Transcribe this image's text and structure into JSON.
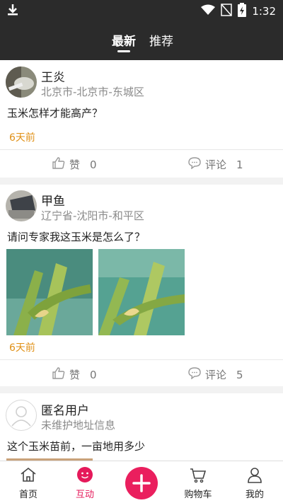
{
  "status": {
    "time": "1:32"
  },
  "tabs": [
    {
      "label": "最新",
      "active": true
    },
    {
      "label": "推荐",
      "active": false
    }
  ],
  "posts": [
    {
      "name": "王炎",
      "location": "北京市-北京市-东城区",
      "question": "玉米怎样才能高产？",
      "time": "6天前",
      "like_label": "赞",
      "like_count": "0",
      "comment_label": "评论",
      "comment_count": "1"
    },
    {
      "name": "甲鱼",
      "location": "辽宁省-沈阳市-和平区",
      "question": "请问专家我这玉米是怎么了？",
      "time": "6天前",
      "like_label": "赞",
      "like_count": "0",
      "comment_label": "评论",
      "comment_count": "5"
    },
    {
      "name": "匿名用户",
      "location": "未维护地址信息",
      "question": "这个玉米苗前，一亩地用多少"
    }
  ],
  "nav": [
    {
      "label": "首页",
      "icon": "home-icon"
    },
    {
      "label": "互动",
      "icon": "interact-icon",
      "active": true
    },
    {
      "label": "",
      "icon": "add-icon"
    },
    {
      "label": "购物车",
      "icon": "cart-icon"
    },
    {
      "label": "我的",
      "icon": "profile-icon"
    }
  ],
  "colors": {
    "accent": "#ea1f5e",
    "time": "#e09016",
    "header": "#2b2b2b"
  }
}
